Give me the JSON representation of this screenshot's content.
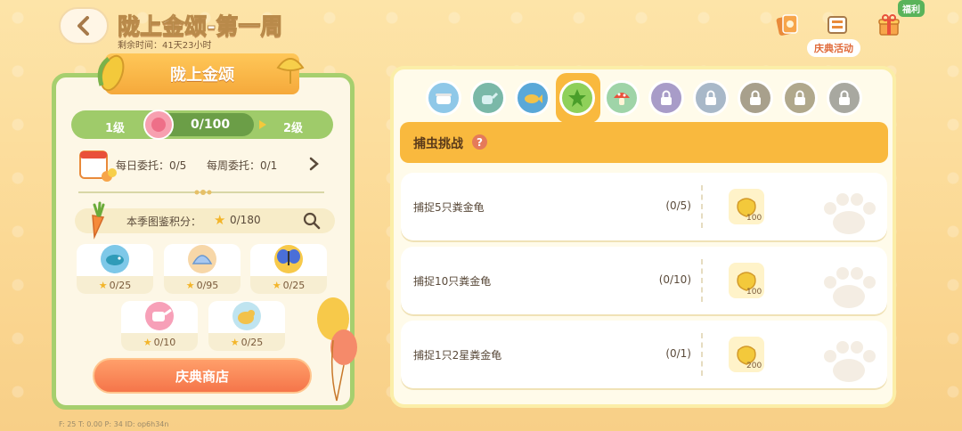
{
  "header": {
    "title": "陇上金颂-第一周",
    "remaining": "剩余时间：41天23小时"
  },
  "top_right": {
    "welfare_badge": "福利",
    "celebrate_label": "庆典活动"
  },
  "left_panel": {
    "ribbon_title": "陇上金颂",
    "level_current": "1级",
    "level_progress": "0/100",
    "level_next": "2级",
    "daily_commission": "每日委托：0/5",
    "weekly_commission": "每周委托：0/1",
    "season_score_label": "本季图鉴积分：",
    "season_score_value": "0/180",
    "collections": [
      {
        "icon": "fish-icon",
        "count": "0/25"
      },
      {
        "icon": "clam-icon",
        "count": "0/95"
      },
      {
        "icon": "butterfly-icon",
        "count": "0/25"
      },
      {
        "icon": "watering-can-icon",
        "count": "0/10"
      },
      {
        "icon": "bird-icon",
        "count": "0/25"
      }
    ],
    "shop_button": "庆典商店"
  },
  "right_panel": {
    "challenge_title": "捕虫挑战",
    "tabs": [
      {
        "icon": "pot-icon",
        "locked": false
      },
      {
        "icon": "watering-can-icon",
        "locked": false
      },
      {
        "icon": "fish-icon",
        "locked": false
      },
      {
        "icon": "leaf-icon",
        "locked": false,
        "selected": true
      },
      {
        "icon": "mushroom-icon",
        "locked": false
      },
      {
        "icon": "lock-icon",
        "locked": true
      },
      {
        "icon": "lock-icon",
        "locked": true
      },
      {
        "icon": "lock-icon",
        "locked": true
      },
      {
        "icon": "lock-icon",
        "locked": true
      },
      {
        "icon": "lock-icon",
        "locked": true
      }
    ],
    "tasks": [
      {
        "name": "捕捉5只粪金龟",
        "progress": "(0/5)",
        "reward": "100"
      },
      {
        "name": "捕捉10只粪金龟",
        "progress": "(0/10)",
        "reward": "100"
      },
      {
        "name": "捕捉1只2星粪金龟",
        "progress": "(0/1)",
        "reward": "200"
      }
    ]
  },
  "debug_info": "F: 25   T: 0.00   P: 34   ID: op6h34n",
  "colors": {
    "accent_orange": "#f9b93e",
    "panel_green": "#a6cf6e",
    "shop_orange": "#f5754a"
  }
}
